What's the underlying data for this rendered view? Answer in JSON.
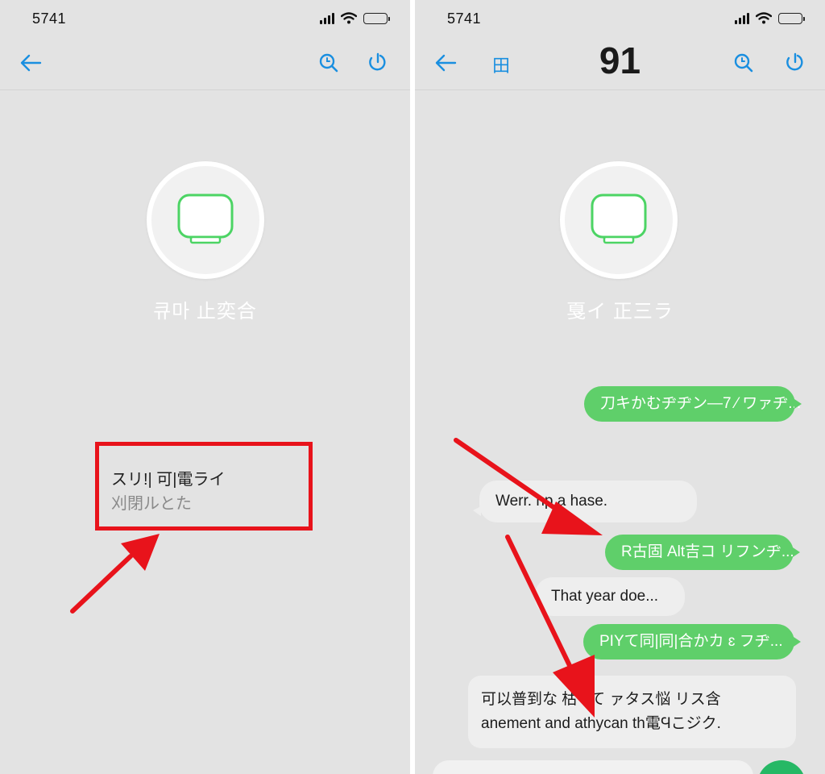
{
  "colors": {
    "accent_blue": "#1a8fe0",
    "bubble_green": "#5fcf6a",
    "annotation_red": "#e8131b",
    "send_green": "#26b865"
  },
  "left": {
    "status": {
      "time": "5741"
    },
    "nav": {
      "back_icon": "back-arrow-icon",
      "search_icon": "search-icon",
      "call_icon": "call-icon"
    },
    "contact": {
      "avatar_icon": "chat-bubble-icon",
      "name": "큐마 止奕合"
    },
    "highlight": {
      "line1": "スリ!| 可|電ライ",
      "line2": "刈閉ルとた"
    }
  },
  "right": {
    "status": {
      "time": "5741"
    },
    "nav": {
      "title": "91",
      "grid_glyph": "田",
      "back_icon": "back-arrow-icon",
      "search_icon": "search-icon",
      "call_icon": "call-icon"
    },
    "contact": {
      "avatar_icon": "chat-bubble-icon",
      "name": "戛イ 正三ラ"
    },
    "messages": [
      {
        "dir": "out",
        "text": "刀キかむヂヂン—7 ⁄ ワァヂ..."
      },
      {
        "dir": "in",
        "text": "Werr. np a hase."
      },
      {
        "dir": "out",
        "text": "R古固 Alt吉コ リフンヂ..."
      },
      {
        "dir": "in",
        "text": "That year doe..."
      },
      {
        "dir": "out",
        "text": "PIYて同|同|合かカ ɛ フヂ..."
      },
      {
        "dir": "in",
        "lines": [
          "可以普到な 枯 ‡て ァタス悩 リス含",
          "anement and athycan th電Ϥこジク."
        ]
      }
    ]
  }
}
